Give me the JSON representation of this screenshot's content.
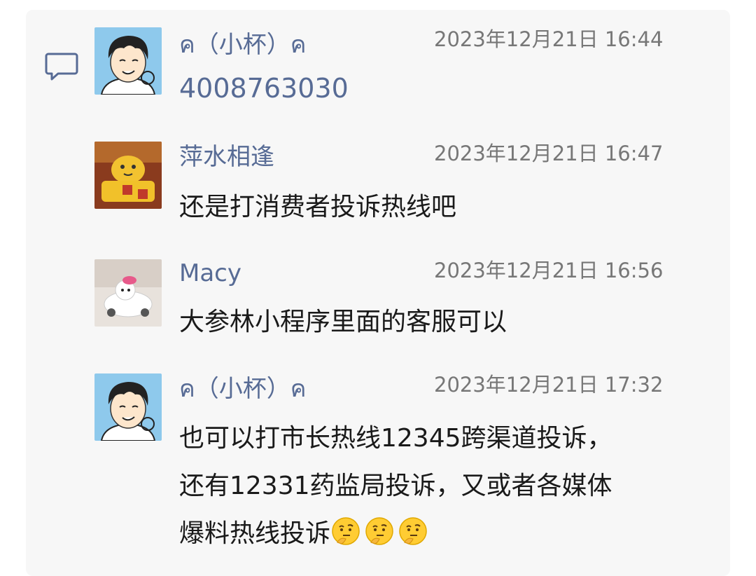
{
  "messages": [
    {
      "author": "ค（小杯）ค",
      "time": "2023年12月21日 16:44",
      "lines": [
        "4008763030"
      ]
    },
    {
      "author": "萍水相逢",
      "time": "2023年12月21日 16:47",
      "lines": [
        "还是打消费者投诉热线吧"
      ]
    },
    {
      "author": "Macy",
      "time": "2023年12月21日 16:56",
      "lines": [
        "大参林小程序里面的客服可以"
      ]
    },
    {
      "author": "ค（小杯）ค",
      "time": "2023年12月21日 17:32",
      "lines": [
        "也可以打市长热线12345跨渠道投诉，",
        "还有12331药监局投诉，又或者各媒体",
        "爆料热线投诉"
      ],
      "trailing_icons": [
        "thinking-face-icon",
        "thinking-face-icon",
        "thinking-face-icon"
      ]
    }
  ],
  "colors": {
    "name": "#576b95",
    "time": "#777777",
    "text": "#1a1a1a",
    "panel": "#f7f7f7"
  }
}
